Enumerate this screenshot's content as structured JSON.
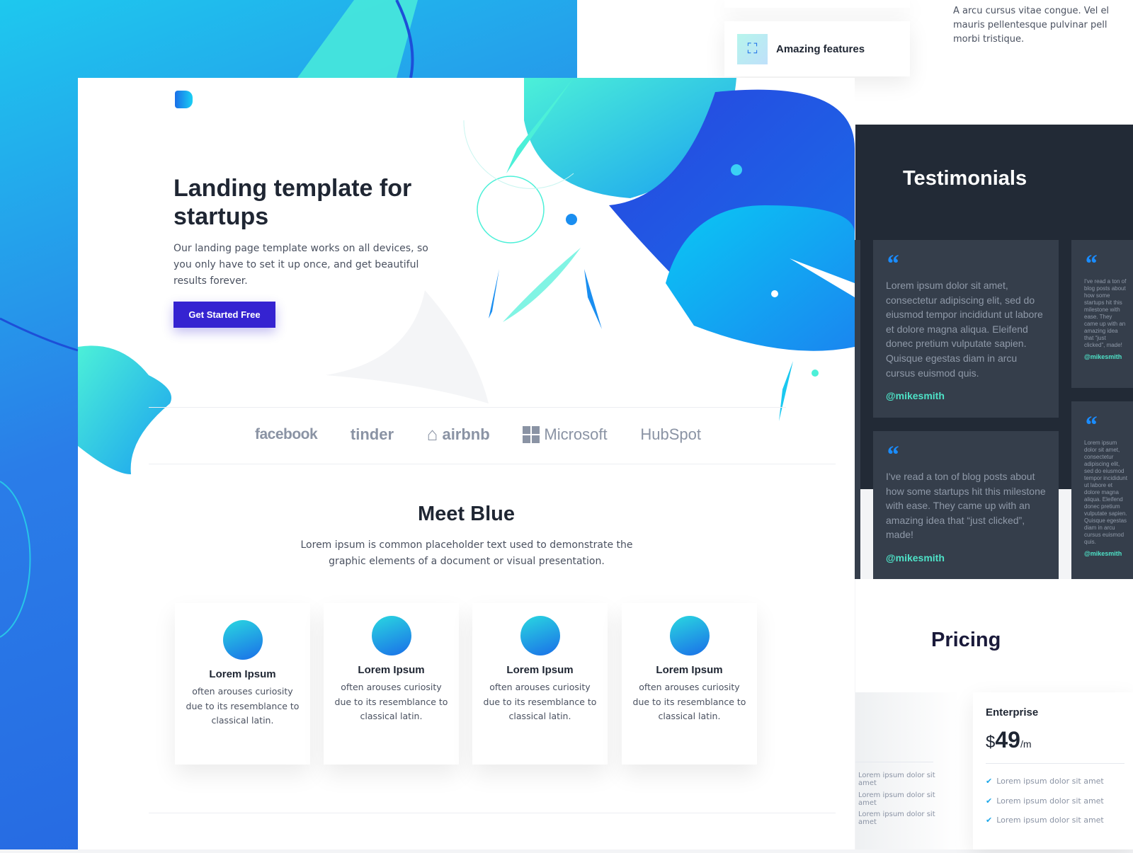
{
  "top_right": {
    "card_label": "Amazing features",
    "paragraph": "A arcu cursus vitae congue. Vel el mauris pellentesque pulvinar pell morbi tristique."
  },
  "hero": {
    "title": "Landing template for startups",
    "subtitle": "Our landing page template works on all devices, so you only have to set it up once, and get beautiful results forever.",
    "cta": "Get Started Free"
  },
  "logos": [
    "facebook",
    "tinder",
    "airbnb",
    "Microsoft",
    "HubSpot"
  ],
  "features": {
    "title": "Meet Blue",
    "subtitle": "Lorem ipsum is common placeholder text used to demonstrate the graphic elements of a document or visual presentation.",
    "cards": [
      {
        "title": "Lorem Ipsum",
        "text": "often arouses curiosity due to its resemblance to classical latin."
      },
      {
        "title": "Lorem Ipsum",
        "text": "often arouses curiosity due to its resemblance to classical latin."
      },
      {
        "title": "Lorem Ipsum",
        "text": "often arouses curiosity due to its resemblance to classical latin."
      },
      {
        "title": "Lorem Ipsum",
        "text": "often arouses curiosity due to its resemblance to classical latin."
      }
    ]
  },
  "testimonials": {
    "title": "Testimonials",
    "quote_mark": "“",
    "items": [
      {
        "text": "Lorem ipsum dolor sit amet, consectetur adipiscing elit, sed do eiusmod tempor incididunt ut labore et dolore magna aliqua. Eleifend donec pretium vulputate sapien. Quisque egestas diam in arcu cursus euismod quis.",
        "handle": "@mikesmith"
      },
      {
        "text": "I've read a ton of blog posts about how some startups hit this milestone with ease. They came up with an amazing idea that “just clicked”, made!",
        "handle": "@mikesmith"
      },
      {
        "text": "I've read a ton of blog posts about how some startups hit this milestone with ease. They came up with an amazing idea that “just clicked”, made!",
        "handle": "@mikesmith"
      },
      {
        "text": "Lorem ipsum dolor sit amet, consectetur adipiscing elit, sed do eiusmod tempor incididunt ut labore et dolore magna aliqua. Eleifend donec pretium vulputate sapien. Quisque egestas diam in arcu cursus euismod quis.",
        "handle": "@mikesmith"
      }
    ]
  },
  "pricing": {
    "title": "Pricing",
    "partial_items": [
      "Lorem ipsum dolor sit amet",
      "Lorem ipsum dolor sit amet",
      "Lorem ipsum dolor sit amet"
    ],
    "plan": {
      "name": "Enterprise",
      "currency": "$",
      "price": "49",
      "period": "/m",
      "items": [
        "Lorem ipsum dolor sit amet",
        "Lorem ipsum dolor sit amet",
        "Lorem ipsum dolor sit amet"
      ]
    }
  },
  "colors": {
    "primary": "#3523d1",
    "accent": "#4ee2c7",
    "dark": "#222a36",
    "blue": "#1a8cff"
  }
}
